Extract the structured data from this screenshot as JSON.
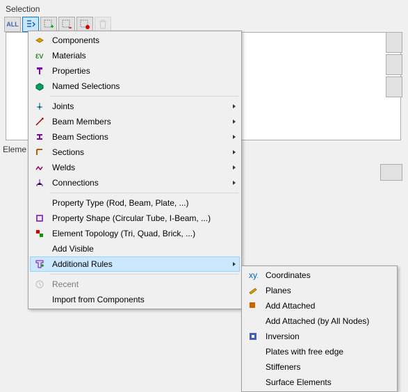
{
  "panel": {
    "title": "Selection",
    "elem_label": "Eleme"
  },
  "toolbar": {
    "all": "ALL"
  },
  "menu1": {
    "components": "Components",
    "materials": "Materials",
    "properties": "Properties",
    "named_selections": "Named Selections",
    "joints": "Joints",
    "beam_members": "Beam Members",
    "beam_sections": "Beam Sections",
    "sections": "Sections",
    "welds": "Welds",
    "connections": "Connections",
    "property_type": "Property Type (Rod, Beam, Plate, ...)",
    "property_shape": "Property Shape (Circular Tube, I-Beam, ...)",
    "element_topology": "Element Topology (Tri, Quad, Brick, ...)",
    "add_visible": "Add Visible",
    "additional_rules": "Additional Rules",
    "recent": "Recent",
    "import_components": "Import from Components"
  },
  "menu2": {
    "coordinates": "Coordinates",
    "planes": "Planes",
    "add_attached": "Add Attached",
    "add_attached_all": "Add Attached (by All Nodes)",
    "inversion": "Inversion",
    "plates_free_edge": "Plates with free edge",
    "stiffeners": "Stiffeners",
    "surface_elements": "Surface Elements"
  }
}
